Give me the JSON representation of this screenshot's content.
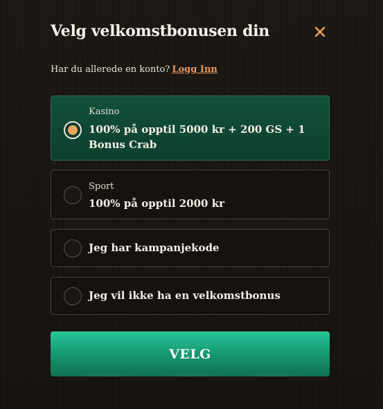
{
  "modal": {
    "title": "Velg velkomstbonusen din",
    "login_prompt": "Har du allerede en konto?",
    "login_link": "Logg Inn"
  },
  "options": [
    {
      "category": "Kasino",
      "label": "100% på opptil 5000 kr + 200 GS + 1 Bonus Crab",
      "selected": true
    },
    {
      "category": "Sport",
      "label": "100% på opptil 2000 kr",
      "selected": false
    },
    {
      "category": "",
      "label": "Jeg har kampanjekode",
      "selected": false
    },
    {
      "category": "",
      "label": "Jeg vil ikke ha en velkomstbonus",
      "selected": false
    }
  ],
  "cta": {
    "label": "VELG"
  },
  "colors": {
    "accent": "#e8a35e",
    "selected_bg": "#12503b",
    "cta": "#1aa982"
  },
  "icons": {
    "close": "close-icon"
  }
}
